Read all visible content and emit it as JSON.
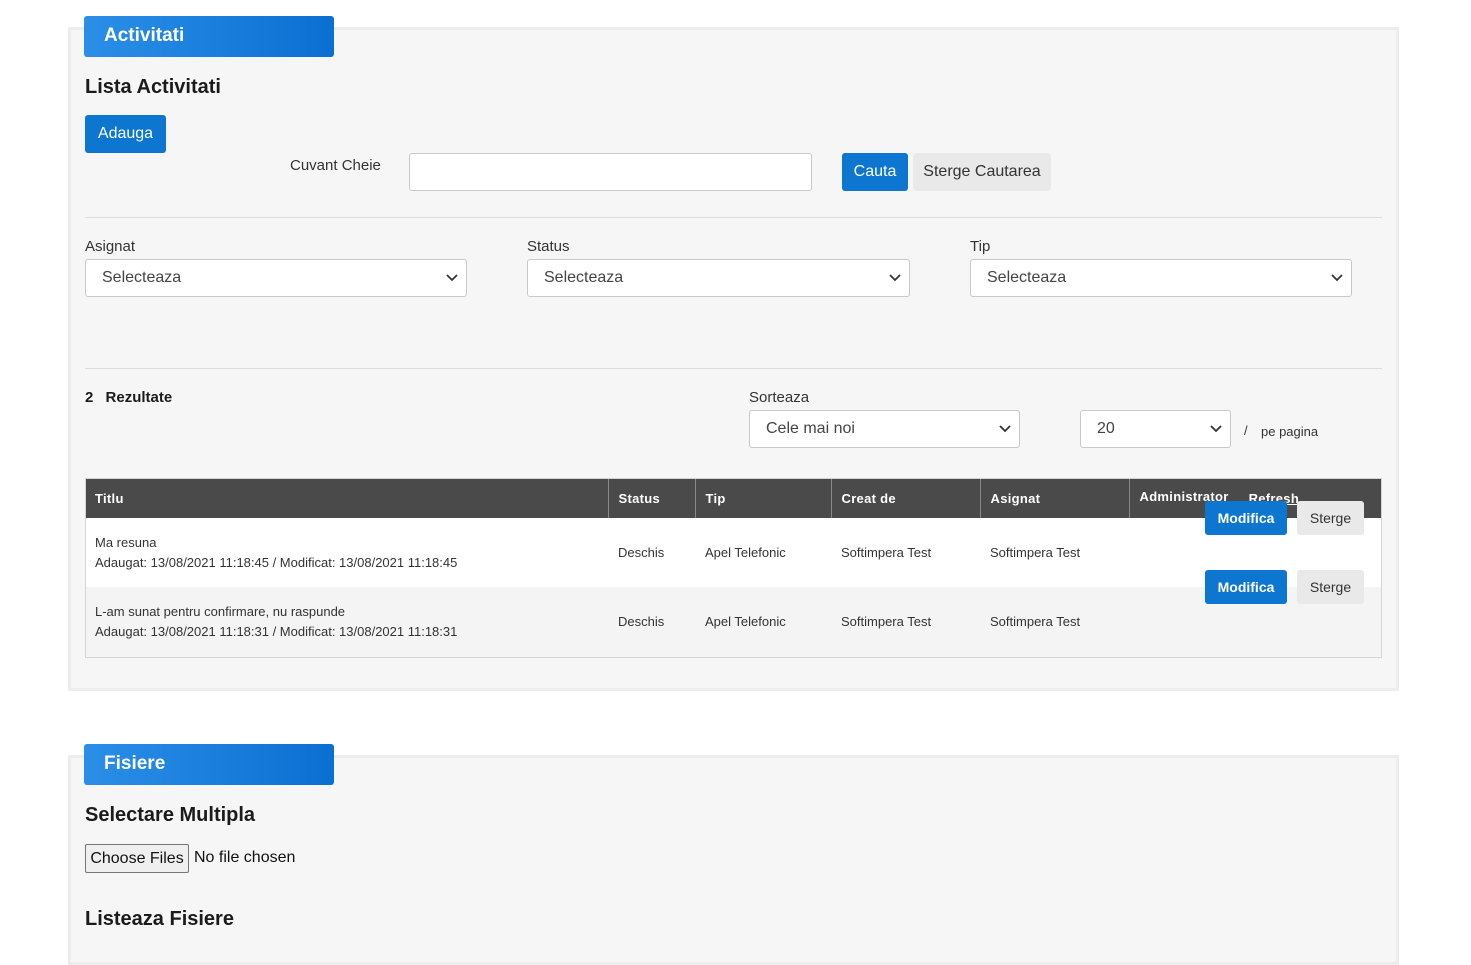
{
  "activitati": {
    "ribbon": "Activitati",
    "title": "Lista Activitati",
    "add_label": "Adauga",
    "keyword_label": "Cuvant Cheie",
    "keyword_value": "",
    "search_label": "Cauta",
    "clear_label": "Sterge Cautarea",
    "filters": {
      "asignat_label": "Asignat",
      "asignat_value": "Selecteaza",
      "status_label": "Status",
      "status_value": "Selecteaza",
      "tip_label": "Tip",
      "tip_value": "Selecteaza"
    },
    "results_count": "2",
    "results_label": "Rezultate",
    "sort_label": "Sorteaza",
    "sort_value": "Cele mai noi",
    "per_page_value": "20",
    "per_page_sep": "/",
    "per_page_label": "pe pagina",
    "table": {
      "headers": [
        "Titlu",
        "Status",
        "Tip",
        "Creat de",
        "Asignat",
        "Administrator"
      ],
      "refresh_label": "Refresh",
      "rows": [
        {
          "title": "Ma resuna",
          "meta": "Adaugat: 13/08/2021 11:18:45 / Modificat: 13/08/2021 11:18:45",
          "status": "Deschis",
          "tip": "Apel Telefonic",
          "creat_de": "Softimpera Test",
          "asignat": "Softimpera Test",
          "edit_label": "Modifica",
          "delete_label": "Sterge"
        },
        {
          "title": "L-am sunat pentru confirmare, nu raspunde",
          "meta": "Adaugat: 13/08/2021 11:18:31 / Modificat: 13/08/2021 11:18:31",
          "status": "Deschis",
          "tip": "Apel Telefonic",
          "creat_de": "Softimpera Test",
          "asignat": "Softimpera Test",
          "edit_label": "Modifica",
          "delete_label": "Sterge"
        }
      ]
    }
  },
  "fisiere": {
    "ribbon": "Fisiere",
    "multi_title": "Selectare Multipla",
    "choose_label": "Choose Files",
    "no_file_label": "No file chosen",
    "list_title": "Listeaza Fisiere"
  },
  "colors": {
    "primary": "#0c76d0",
    "ribbon_start": "#2b8fe8",
    "ribbon_end": "#0a6fd2",
    "table_header": "#4a4a4a",
    "panel_bg": "#f6f6f6"
  },
  "icons": {
    "select_arrow": "chevron-down-icon"
  }
}
